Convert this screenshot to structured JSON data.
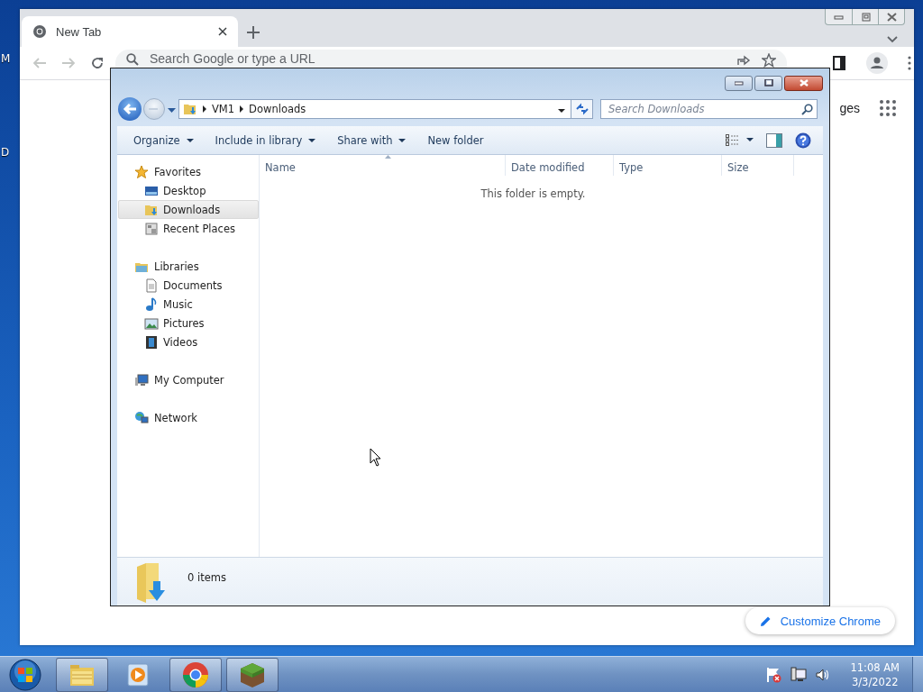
{
  "desktop": {
    "icon_labels": [
      "M",
      "D"
    ]
  },
  "chrome": {
    "tabs": [
      {
        "title": "New Tab",
        "selected": true
      }
    ],
    "omnibox": {
      "placeholder": "Search Google or type a URL"
    },
    "shortcut_link": "ges",
    "customize_button": "Customize Chrome"
  },
  "explorer": {
    "breadcrumb": [
      "VM1",
      "Downloads"
    ],
    "search": {
      "placeholder": "Search Downloads"
    },
    "commands": [
      {
        "label": "Organize",
        "kind": "menu"
      },
      {
        "label": "Include in library",
        "kind": "menu"
      },
      {
        "label": "Share with",
        "kind": "menu"
      },
      {
        "label": "New folder",
        "kind": "action"
      }
    ],
    "navigation": [
      {
        "label": "Favorites",
        "selected": false,
        "children": [
          {
            "label": "Desktop",
            "selected": false
          },
          {
            "label": "Downloads",
            "selected": true
          },
          {
            "label": "Recent Places",
            "selected": false
          }
        ]
      },
      {
        "label": "Libraries",
        "selected": false,
        "children": [
          {
            "label": "Documents",
            "selected": false
          },
          {
            "label": "Music",
            "selected": false
          },
          {
            "label": "Pictures",
            "selected": false
          },
          {
            "label": "Videos",
            "selected": false
          }
        ]
      },
      {
        "label": "My Computer",
        "selected": false
      },
      {
        "label": "Network",
        "selected": false
      }
    ],
    "columns": [
      "Name",
      "Date modified",
      "Type",
      "Size"
    ],
    "empty_message": "This folder is empty.",
    "status": "0 items"
  },
  "taskbar": {
    "buttons": [
      {
        "kind": "explorer",
        "running": true
      },
      {
        "kind": "media-player",
        "running": false
      },
      {
        "kind": "chrome",
        "running": true
      },
      {
        "kind": "block-game",
        "running": true
      }
    ],
    "clock": {
      "time": "11:08 AM",
      "date": "3/3/2022"
    }
  }
}
